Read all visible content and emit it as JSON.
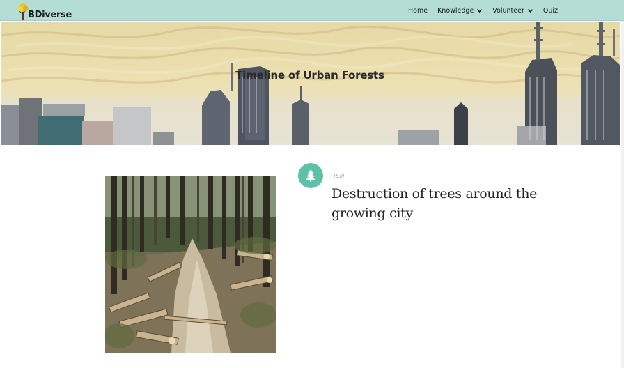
{
  "brand": {
    "name": "BDiverse",
    "logo_icon": "tree-logo-icon"
  },
  "nav": {
    "items": [
      {
        "label": "Home",
        "has_dropdown": false
      },
      {
        "label": "Knowledge",
        "has_dropdown": true
      },
      {
        "label": "Volunteer",
        "has_dropdown": true
      },
      {
        "label": "Quiz",
        "has_dropdown": false
      }
    ]
  },
  "hero": {
    "title": "Timeline of Urban Forests"
  },
  "timeline": {
    "events": [
      {
        "year": "1830",
        "title": "Destruction of trees around the growing city",
        "marker_icon": "tree-icon"
      }
    ]
  },
  "colors": {
    "navbar": "#b4ddd6",
    "marker": "#5cc1a6"
  }
}
